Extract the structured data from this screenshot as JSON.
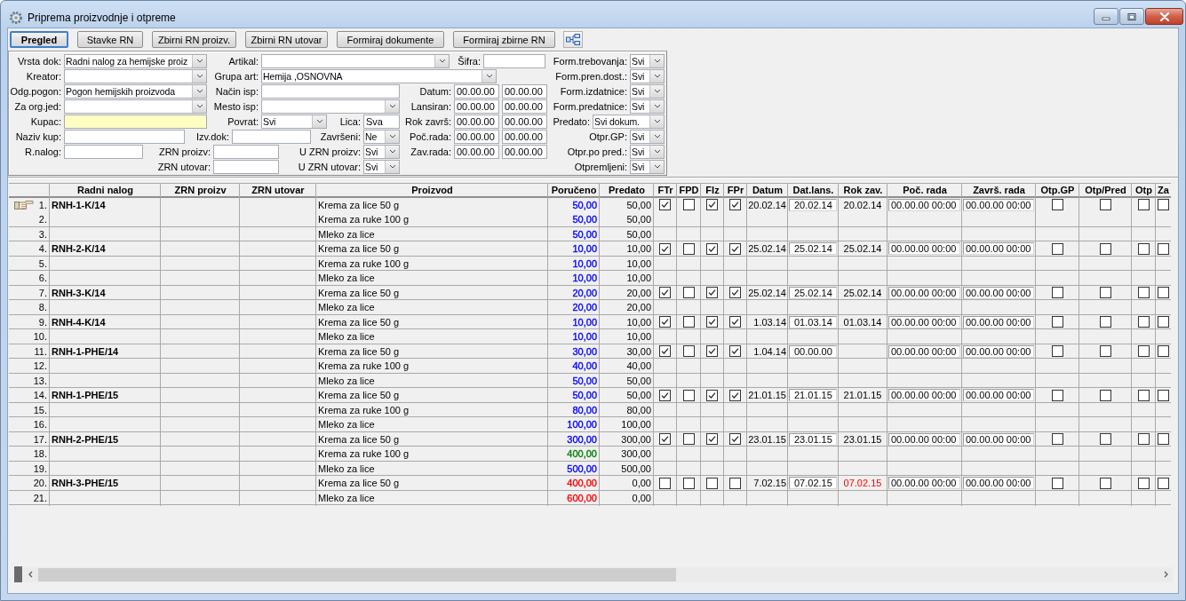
{
  "window": {
    "title": "Priprema proizvodnje i otpreme"
  },
  "toolbar": {
    "buttons": [
      {
        "label": "Pregled",
        "selected": true
      },
      {
        "label": "Stavke RN",
        "selected": false
      },
      {
        "label": "Zbirni RN proizv.",
        "selected": false
      },
      {
        "label": "Zbirni RN utovar",
        "selected": false
      },
      {
        "label": "Formiraj dokumente",
        "selected": false
      },
      {
        "label": "Formiraj zbirne RN",
        "selected": false
      }
    ]
  },
  "filter_panel": {
    "rows": [
      {
        "fields": [
          {
            "label": "Vrsta dok:",
            "kind": "combo",
            "value": "Radni nalog za hemijske proiz",
            "highlighted": false
          },
          {
            "label": "Artikal:",
            "kind": "combo",
            "highlighted": false
          },
          {
            "label": "Šifra:",
            "kind": "text",
            "highlighted": false
          },
          {
            "label": "Form.trebovanja:",
            "kind": "combo",
            "value": "Svi",
            "highlighted": false
          }
        ]
      },
      {
        "fields": [
          {
            "label": "Kreator:",
            "kind": "combo",
            "highlighted": false
          },
          {
            "label": "Grupa art:",
            "kind": "combo",
            "value": "Hemija ,OSNOVNA",
            "highlighted": false
          },
          {
            "label": "Form.pren.dost.:",
            "kind": "combo",
            "value": "Svi",
            "highlighted": false
          }
        ]
      },
      {
        "fields": [
          {
            "label": "Odg.pogon:",
            "kind": "combo",
            "value": "Pogon hemijskih proizvoda",
            "highlighted": false
          },
          {
            "label": "Način isp:",
            "kind": "text",
            "highlighted": false
          },
          {
            "label": "Datum:",
            "kind": "date_range",
            "from": "00.00.00",
            "to": "00.00.00",
            "highlighted": false
          },
          {
            "label": "Form.izdatnice:",
            "kind": "combo",
            "value": "Svi",
            "highlighted": false
          }
        ]
      },
      {
        "fields": [
          {
            "label": "Za org.jed:",
            "kind": "combo",
            "highlighted": false
          },
          {
            "label": "Mesto isp:",
            "kind": "combo",
            "highlighted": false
          },
          {
            "label": "Lansiran:",
            "kind": "date_range",
            "from": "00.00.00",
            "to": "00.00.00",
            "highlighted": false
          },
          {
            "label": "Form.predatnice:",
            "kind": "combo",
            "value": "Svi",
            "highlighted": false
          }
        ]
      },
      {
        "fields": [
          {
            "label": "Kupac:",
            "kind": "text",
            "highlighted": true
          },
          {
            "label": "Povrat:",
            "kind": "combo",
            "value": "Svi",
            "highlighted": false
          },
          {
            "label": "Lica:",
            "kind": "text",
            "value": "Sva",
            "highlighted": false
          },
          {
            "label": "Rok završ:",
            "kind": "date_range",
            "from": "00.00.00",
            "to": "00.00.00",
            "highlighted": false
          },
          {
            "label": "Predato:",
            "kind": "combo",
            "value": "Svi dokum.",
            "highlighted": false
          }
        ]
      },
      {
        "fields": [
          {
            "label": "Naziv kup:",
            "kind": "text",
            "highlighted": false
          },
          {
            "label": "Izv.dok:",
            "kind": "text",
            "highlighted": false
          },
          {
            "label": "Završeni:",
            "kind": "combo",
            "value": "Ne",
            "highlighted": false
          },
          {
            "label": "Poč.rada:",
            "kind": "date_range",
            "from": "00.00.00",
            "to": "00.00.00",
            "highlighted": false
          },
          {
            "label": "Otpr.GP:",
            "kind": "combo",
            "value": "Svi",
            "highlighted": false
          }
        ]
      },
      {
        "fields": [
          {
            "label": "R.nalog:",
            "kind": "text",
            "highlighted": false
          },
          {
            "label": "ZRN proizv:",
            "kind": "text",
            "highlighted": false
          },
          {
            "label": "U ZRN proizv:",
            "kind": "combo",
            "value": "Svi",
            "highlighted": false
          },
          {
            "label": "Zav.rada:",
            "kind": "date_range",
            "from": "00.00.00",
            "to": "00.00.00",
            "highlighted": false
          },
          {
            "label": "Otpr.po pred.:",
            "kind": "combo",
            "value": "Svi",
            "highlighted": false
          }
        ]
      },
      {
        "fields": [
          {
            "label": "ZRN utovar:",
            "kind": "text",
            "highlighted": false
          },
          {
            "label": "U ZRN utovar:",
            "kind": "combo",
            "value": "Svi",
            "highlighted": false
          },
          {
            "label": "Otpremljeni:",
            "kind": "combo",
            "value": "Svi",
            "highlighted": false
          }
        ]
      }
    ]
  },
  "table": {
    "columns": [
      {
        "label": "Radni nalog"
      },
      {
        "label": "ZRN proizv"
      },
      {
        "label": "ZRN utovar"
      },
      {
        "label": "Proizvod"
      },
      {
        "label": "Poručeno"
      },
      {
        "label": "Predato"
      },
      {
        "label": "FTr"
      },
      {
        "label": "FPD"
      },
      {
        "label": "FIz"
      },
      {
        "label": "FPr"
      },
      {
        "label": "Datum"
      },
      {
        "label": "Dat.lans."
      },
      {
        "label": "Rok zav."
      },
      {
        "label": "Poč. rada"
      },
      {
        "label": "Završ. rada"
      },
      {
        "label": "Otp.GP"
      },
      {
        "label": "Otp/Pred"
      },
      {
        "label": "Otp"
      },
      {
        "label": "Za"
      }
    ],
    "rows": [
      {
        "no": "1.",
        "selected": true,
        "order": "RNH-1-K/14",
        "product": "Krema za lice 50 g",
        "ordered": {
          "text": "50,00",
          "color": "#0000ff"
        },
        "delivered": "50,00",
        "flags": [
          {
            "checked": true
          },
          {
            "checked": false
          },
          {
            "checked": true
          },
          {
            "checked": true
          }
        ],
        "date": "20.02.14",
        "launch_date": "20.02.14",
        "due": {
          "text": "20.02.14",
          "color": "#000000"
        },
        "work_start": "00.00.00 00:00",
        "work_end": "00.00.00 00:00",
        "shipping": [
          {
            "checked": false
          },
          {
            "checked": false
          },
          {
            "checked": false
          },
          {
            "checked": false
          }
        ]
      },
      {
        "no": "2.",
        "selected": false,
        "product": "Krema za ruke 100 g",
        "ordered": {
          "text": "50,00",
          "color": "#0000ff"
        },
        "delivered": "50,00"
      },
      {
        "no": "3.",
        "selected": false,
        "product": "Mleko za lice",
        "ordered": {
          "text": "50,00",
          "color": "#0000ff"
        },
        "delivered": "50,00"
      },
      {
        "no": "4.",
        "selected": false,
        "order": "RNH-2-K/14",
        "product": "Krema za lice 50 g",
        "ordered": {
          "text": "10,00",
          "color": "#0000ff"
        },
        "delivered": "10,00",
        "flags": [
          {
            "checked": true
          },
          {
            "checked": false
          },
          {
            "checked": true
          },
          {
            "checked": true
          }
        ],
        "date": "25.02.14",
        "launch_date": "25.02.14",
        "due": {
          "text": "25.02.14",
          "color": "#000000"
        },
        "work_start": "00.00.00 00:00",
        "work_end": "00.00.00 00:00",
        "shipping": [
          {
            "checked": false
          },
          {
            "checked": false
          },
          {
            "checked": false
          },
          {
            "checked": false
          }
        ]
      },
      {
        "no": "5.",
        "selected": false,
        "product": "Krema za ruke 100 g",
        "ordered": {
          "text": "10,00",
          "color": "#0000ff"
        },
        "delivered": "10,00"
      },
      {
        "no": "6.",
        "selected": false,
        "product": "Mleko za lice",
        "ordered": {
          "text": "10,00",
          "color": "#0000ff"
        },
        "delivered": "10,00"
      },
      {
        "no": "7.",
        "selected": false,
        "order": "RNH-3-K/14",
        "product": "Krema za lice 50 g",
        "ordered": {
          "text": "20,00",
          "color": "#0000ff"
        },
        "delivered": "20,00",
        "flags": [
          {
            "checked": true
          },
          {
            "checked": false
          },
          {
            "checked": true
          },
          {
            "checked": true
          }
        ],
        "date": "25.02.14",
        "launch_date": "25.02.14",
        "due": {
          "text": "25.02.14",
          "color": "#000000"
        },
        "work_start": "00.00.00 00:00",
        "work_end": "00.00.00 00:00",
        "shipping": [
          {
            "checked": false
          },
          {
            "checked": false
          },
          {
            "checked": false
          },
          {
            "checked": false
          }
        ]
      },
      {
        "no": "8.",
        "selected": false,
        "product": "Mleko za lice",
        "ordered": {
          "text": "20,00",
          "color": "#0000ff"
        },
        "delivered": "20,00"
      },
      {
        "no": "9.",
        "selected": false,
        "order": "RNH-4-K/14",
        "product": "Krema za lice 50 g",
        "ordered": {
          "text": "10,00",
          "color": "#0000ff"
        },
        "delivered": "10,00",
        "flags": [
          {
            "checked": true
          },
          {
            "checked": false
          },
          {
            "checked": true
          },
          {
            "checked": true
          }
        ],
        "date": "1.03.14",
        "launch_date": "01.03.14",
        "due": {
          "text": "01.03.14",
          "color": "#000000"
        },
        "work_start": "00.00.00 00:00",
        "work_end": "00.00.00 00:00",
        "shipping": [
          {
            "checked": false
          },
          {
            "checked": false
          },
          {
            "checked": false
          },
          {
            "checked": false
          }
        ]
      },
      {
        "no": "10.",
        "selected": false,
        "product": "Mleko za lice",
        "ordered": {
          "text": "10,00",
          "color": "#0000ff"
        },
        "delivered": "10,00"
      },
      {
        "no": "11.",
        "selected": false,
        "order": "RNH-1-PHE/14",
        "product": "Krema za lice 50 g",
        "ordered": {
          "text": "30,00",
          "color": "#0000ff"
        },
        "delivered": "30,00",
        "flags": [
          {
            "checked": true
          },
          {
            "checked": false
          },
          {
            "checked": true
          },
          {
            "checked": true
          }
        ],
        "date": "1.04.14",
        "launch_date": "00.00.00",
        "work_start": "00.00.00 00:00",
        "work_end": "00.00.00 00:00",
        "shipping": [
          {
            "checked": false
          },
          {
            "checked": false
          },
          {
            "checked": false
          },
          {
            "checked": false
          }
        ]
      },
      {
        "no": "12.",
        "selected": false,
        "product": "Krema za ruke 100 g",
        "ordered": {
          "text": "40,00",
          "color": "#0000ff"
        },
        "delivered": "40,00"
      },
      {
        "no": "13.",
        "selected": false,
        "product": "Mleko za lice",
        "ordered": {
          "text": "50,00",
          "color": "#0000ff"
        },
        "delivered": "50,00"
      },
      {
        "no": "14.",
        "selected": false,
        "order": "RNH-1-PHE/15",
        "product": "Krema za lice 50 g",
        "ordered": {
          "text": "50,00",
          "color": "#0000ff"
        },
        "delivered": "50,00",
        "flags": [
          {
            "checked": true
          },
          {
            "checked": false
          },
          {
            "checked": true
          },
          {
            "checked": true
          }
        ],
        "date": "21.01.15",
        "launch_date": "21.01.15",
        "due": {
          "text": "21.01.15",
          "color": "#000000"
        },
        "work_start": "00.00.00 00:00",
        "work_end": "00.00.00 00:00",
        "shipping": [
          {
            "checked": false
          },
          {
            "checked": false
          },
          {
            "checked": false
          },
          {
            "checked": false
          }
        ]
      },
      {
        "no": "15.",
        "selected": false,
        "product": "Krema za ruke 100 g",
        "ordered": {
          "text": "80,00",
          "color": "#0000ff"
        },
        "delivered": "80,00"
      },
      {
        "no": "16.",
        "selected": false,
        "product": "Mleko za lice",
        "ordered": {
          "text": "100,00",
          "color": "#0000ff"
        },
        "delivered": "100,00"
      },
      {
        "no": "17.",
        "selected": false,
        "order": "RNH-2-PHE/15",
        "product": "Krema za lice 50 g",
        "ordered": {
          "text": "300,00",
          "color": "#0000ff"
        },
        "delivered": "300,00",
        "flags": [
          {
            "checked": true
          },
          {
            "checked": false
          },
          {
            "checked": true
          },
          {
            "checked": true
          }
        ],
        "date": "23.01.15",
        "launch_date": "23.01.15",
        "due": {
          "text": "23.01.15",
          "color": "#000000"
        },
        "work_start": "00.00.00 00:00",
        "work_end": "00.00.00 00:00",
        "shipping": [
          {
            "checked": false
          },
          {
            "checked": false
          },
          {
            "checked": false
          },
          {
            "checked": false
          }
        ]
      },
      {
        "no": "18.",
        "selected": false,
        "product": "Krema za ruke 100 g",
        "ordered": {
          "text": "400,00",
          "color": "#008000"
        },
        "delivered": "300,00"
      },
      {
        "no": "19.",
        "selected": false,
        "product": "Mleko za lice",
        "ordered": {
          "text": "500,00",
          "color": "#0000ff"
        },
        "delivered": "500,00"
      },
      {
        "no": "20.",
        "selected": false,
        "order": "RNH-3-PHE/15",
        "product": "Krema za lice 50 g",
        "ordered": {
          "text": "400,00",
          "color": "#ff0000"
        },
        "delivered": "0,00",
        "flags": [
          {
            "checked": false
          },
          {
            "checked": false
          },
          {
            "checked": false
          },
          {
            "checked": false
          }
        ],
        "date": "7.02.15",
        "launch_date": "07.02.15",
        "due": {
          "text": "07.02.15",
          "color": "#ff0000"
        },
        "work_start": "00.00.00 00:00",
        "work_end": "00.00.00 00:00",
        "shipping": [
          {
            "checked": false
          },
          {
            "checked": false
          },
          {
            "checked": false
          },
          {
            "checked": false
          }
        ]
      },
      {
        "no": "21.",
        "selected": false,
        "product": "Mleko za lice",
        "ordered": {
          "text": "600,00",
          "color": "#ff0000"
        },
        "delivered": "0,00"
      }
    ]
  }
}
